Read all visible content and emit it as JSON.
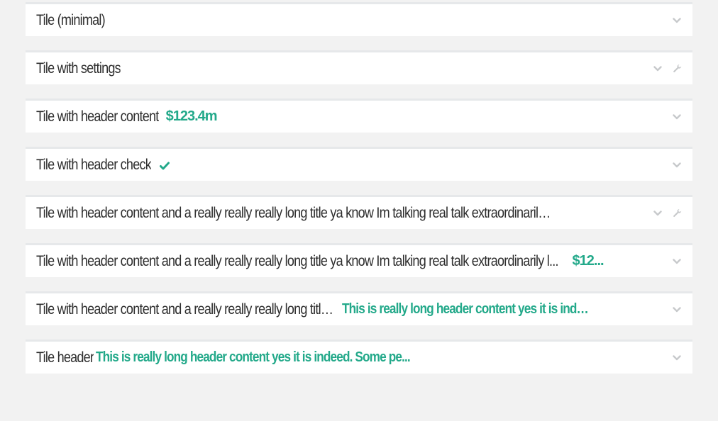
{
  "colors": {
    "background": "#f2f2f2",
    "tile": "#ffffff",
    "tile_border": "#e6e8ea",
    "accent": "#23a98a",
    "text": "#2e2e2e",
    "icon": "#c7c9cb"
  },
  "tiles": [
    {
      "title": "Tile (minimal)",
      "extra": "",
      "icons": [
        "chevron-down-icon"
      ]
    },
    {
      "title": "Tile with settings",
      "extra": "",
      "icons": [
        "chevron-down-icon",
        "wrench-icon"
      ]
    },
    {
      "title": "Tile with header content",
      "extra": "$123.4m",
      "icons": [
        "chevron-down-icon"
      ]
    },
    {
      "title": "Tile with header check",
      "extra": "",
      "check_icon": "check-icon",
      "icons": [
        "chevron-down-icon"
      ]
    },
    {
      "title": "Tile with header content and a really really really long title ya know Im talking real talk extraordinarily long ...",
      "extra": "",
      "icons": [
        "chevron-down-icon",
        "wrench-icon"
      ]
    },
    {
      "title": "Tile with header content and a really really really long title ya know Im talking real talk extraordinarily l...",
      "extra": "$12...",
      "icons": [
        "chevron-down-icon"
      ]
    },
    {
      "title": "Tile with header content and a really really really long title ya...",
      "extra": "This is really long header content yes it is indeed. ...",
      "icons": [
        "chevron-down-icon"
      ]
    },
    {
      "title": "Tile header",
      "extra": "This is really long header content yes it is indeed. Some pe...",
      "icons": [
        "chevron-down-icon"
      ]
    }
  ]
}
